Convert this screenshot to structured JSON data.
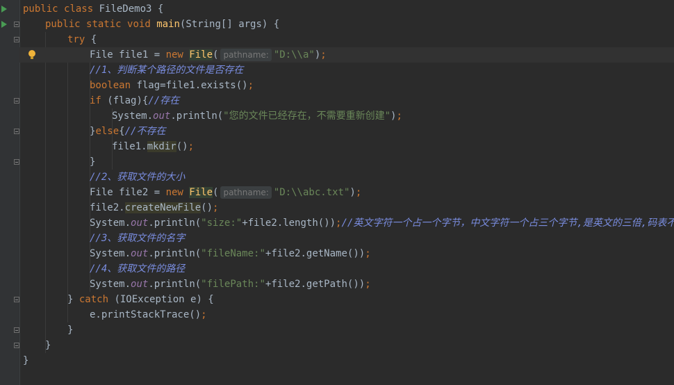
{
  "lines": [
    {
      "indent": 0,
      "tokens": [
        [
          "kw",
          "public "
        ],
        [
          "kw",
          "class "
        ],
        [
          "pl",
          "FileDemo3 {"
        ]
      ]
    },
    {
      "indent": 1,
      "tokens": [
        [
          "kw",
          "public "
        ],
        [
          "kw",
          "static "
        ],
        [
          "kw",
          "void "
        ],
        [
          "fn",
          "main"
        ],
        [
          "pl",
          "(String[] args) {"
        ]
      ]
    },
    {
      "indent": 2,
      "tokens": [
        [
          "kw",
          "try "
        ],
        [
          "pl",
          "{"
        ]
      ]
    },
    {
      "indent": 3,
      "tokens": [
        [
          "pl",
          "File file1 = "
        ],
        [
          "kw",
          "new "
        ],
        [
          "fnhl",
          "File"
        ],
        [
          "pl",
          "("
        ],
        [
          "hint",
          "pathname:"
        ],
        [
          "str",
          "\"D:\\\\a\""
        ],
        [
          "pl",
          ")"
        ],
        [
          "kw",
          ";"
        ]
      ]
    },
    {
      "indent": 3,
      "tokens": [
        [
          "cmb",
          "//1、判断某个路径的文件是否存在"
        ]
      ]
    },
    {
      "indent": 3,
      "tokens": [
        [
          "kw",
          "boolean "
        ],
        [
          "pl",
          "flag=file1.exists()"
        ],
        [
          "kw",
          ";"
        ]
      ]
    },
    {
      "indent": 3,
      "tokens": [
        [
          "kw",
          "if "
        ],
        [
          "pl",
          "(flag){"
        ],
        [
          "cmb",
          "//存在"
        ]
      ]
    },
    {
      "indent": 4,
      "tokens": [
        [
          "pl",
          "System."
        ],
        [
          "fld",
          "out"
        ],
        [
          "pl",
          ".println("
        ],
        [
          "str",
          "\"您的文件已经存在，不需要重新创建\""
        ],
        [
          "pl",
          ")"
        ],
        [
          "kw",
          ";"
        ]
      ]
    },
    {
      "indent": 3,
      "tokens": [
        [
          "pl",
          "}"
        ],
        [
          "kw",
          "else"
        ],
        [
          "pl",
          "{"
        ],
        [
          "cmb",
          "//不存在"
        ]
      ]
    },
    {
      "indent": 4,
      "tokens": [
        [
          "pl",
          "file1."
        ],
        [
          "hl",
          "mkdir"
        ],
        [
          "pl",
          "()"
        ],
        [
          "kw",
          ";"
        ]
      ]
    },
    {
      "indent": 3,
      "tokens": [
        [
          "pl",
          "}"
        ]
      ]
    },
    {
      "indent": 3,
      "tokens": [
        [
          "cmb",
          "//2、获取文件的大小"
        ]
      ]
    },
    {
      "indent": 3,
      "tokens": [
        [
          "pl",
          "File file2 = "
        ],
        [
          "kw",
          "new "
        ],
        [
          "fnhl",
          "File"
        ],
        [
          "pl",
          "("
        ],
        [
          "hint",
          "pathname:"
        ],
        [
          "str",
          "\"D:\\\\abc.txt\""
        ],
        [
          "pl",
          ")"
        ],
        [
          "kw",
          ";"
        ]
      ]
    },
    {
      "indent": 3,
      "tokens": [
        [
          "pl",
          "file2."
        ],
        [
          "hl",
          "createNewFile"
        ],
        [
          "pl",
          "()"
        ],
        [
          "kw",
          ";"
        ]
      ]
    },
    {
      "indent": 3,
      "tokens": [
        [
          "pl",
          "System."
        ],
        [
          "fld",
          "out"
        ],
        [
          "pl",
          ".println("
        ],
        [
          "str",
          "\"size:\""
        ],
        [
          "pl",
          "+file2.length())"
        ],
        [
          "kw",
          ";"
        ],
        [
          "cmb",
          "//英文字符一个占一个字节，中文字符一个占三个字节,是英文的三倍,码表不一样"
        ]
      ]
    },
    {
      "indent": 3,
      "tokens": [
        [
          "cmb",
          "//3、获取文件的名字"
        ]
      ]
    },
    {
      "indent": 3,
      "tokens": [
        [
          "pl",
          "System."
        ],
        [
          "fld",
          "out"
        ],
        [
          "pl",
          ".println("
        ],
        [
          "str",
          "\"fileName:\""
        ],
        [
          "pl",
          "+file2.getName())"
        ],
        [
          "kw",
          ";"
        ]
      ]
    },
    {
      "indent": 3,
      "tokens": [
        [
          "cmb",
          "//4、获取文件的路径"
        ]
      ]
    },
    {
      "indent": 3,
      "tokens": [
        [
          "pl",
          "System."
        ],
        [
          "fld",
          "out"
        ],
        [
          "pl",
          ".println("
        ],
        [
          "str",
          "\"filePath:\""
        ],
        [
          "pl",
          "+file2.getPath())"
        ],
        [
          "kw",
          ";"
        ]
      ]
    },
    {
      "indent": 2,
      "tokens": [
        [
          "pl",
          "} "
        ],
        [
          "kw",
          "catch "
        ],
        [
          "pl",
          "(IOException e) {"
        ]
      ]
    },
    {
      "indent": 3,
      "tokens": [
        [
          "pl",
          "e.printStackTrace()"
        ],
        [
          "kw",
          ";"
        ]
      ]
    },
    {
      "indent": 2,
      "tokens": [
        [
          "pl",
          "}"
        ]
      ]
    },
    {
      "indent": 1,
      "tokens": [
        [
          "pl",
          "}"
        ]
      ]
    },
    {
      "indent": 0,
      "tokens": [
        [
          "pl",
          "}"
        ]
      ]
    }
  ],
  "gutter": {
    "run_lines": [
      0,
      1
    ],
    "fold_lines": [
      1,
      2,
      6,
      8,
      10,
      19,
      21,
      22
    ],
    "bulb_line": 3,
    "current_line": 3
  },
  "icons": {
    "run": "run-icon",
    "fold": "fold-icon",
    "bulb": "intention-bulb-icon"
  }
}
